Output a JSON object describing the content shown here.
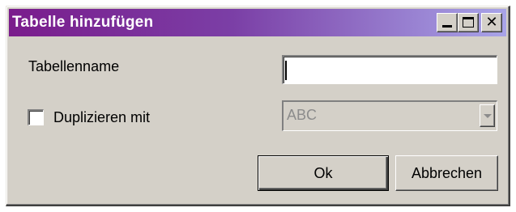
{
  "window": {
    "title": "Tabelle hinzufügen",
    "title_gradient": [
      "#7a1c8c",
      "#a8a4e8"
    ],
    "controls": {
      "minimize": "minimize-icon",
      "maximize": "maximize-icon",
      "close": "close-icon",
      "close_glyph": "✕"
    }
  },
  "form": {
    "table_name_label": "Tabellenname",
    "table_name_value": "",
    "duplicate_label": "Duplizieren mit",
    "duplicate_checked": false,
    "duplicate_select_value": "ABC"
  },
  "buttons": {
    "ok_label": "Ok",
    "cancel_label": "Abbrechen"
  }
}
